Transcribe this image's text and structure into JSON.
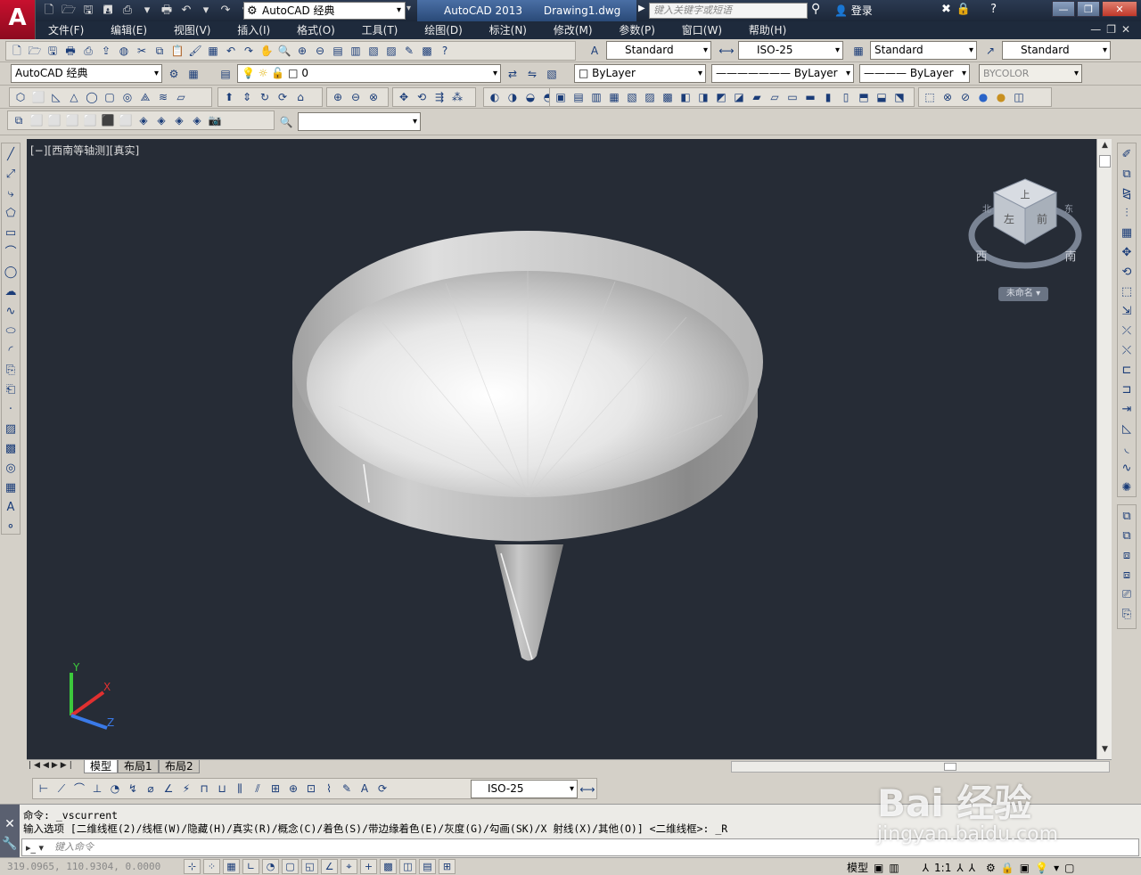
{
  "titlebar": {
    "app_logo": "A",
    "workspace": "AutoCAD 经典",
    "app_name": "AutoCAD 2013",
    "document": "Drawing1.dwg",
    "search_placeholder": "键入关键字或短语",
    "login": "登录",
    "window_buttons": [
      "—",
      "❐",
      "✕"
    ]
  },
  "menu": {
    "items": [
      "文件(F)",
      "编辑(E)",
      "视图(V)",
      "插入(I)",
      "格式(O)",
      "工具(T)",
      "绘图(D)",
      "标注(N)",
      "修改(M)",
      "参数(P)",
      "窗口(W)",
      "帮助(H)"
    ]
  },
  "styles_toolbar": {
    "text_style": "Standard",
    "dim_style": "ISO-25",
    "table_style": "Standard",
    "multileader_style": "Standard"
  },
  "layers_toolbar": {
    "workspace": "AutoCAD 经典",
    "current_layer": "0",
    "color": "ByLayer",
    "linetype": "ByLayer",
    "lineweight": "ByLayer",
    "plot_style": "BYCOLOR"
  },
  "viewport": {
    "label": "[−][西南等轴测][真实]",
    "viewcube_top": "上",
    "viewcube_front": "前",
    "viewcube_left": "左",
    "compass_west": "西",
    "compass_south": "南",
    "compass_north": "北",
    "compass_east": "东",
    "ucs_name": "未命名",
    "ucs_x": "X",
    "ucs_y": "Y",
    "ucs_z": "Z"
  },
  "layout_tabs": [
    "模型",
    "布局1",
    "布局2"
  ],
  "dim_toolbar": {
    "dim_style": "ISO-25"
  },
  "command": {
    "line1": "命令: _vscurrent",
    "line2": "输入选项 [二维线框(2)/线框(W)/隐藏(H)/真实(R)/概念(C)/着色(S)/带边缘着色(E)/灰度(G)/勾画(SK)/X 射线(X)/其他(O)] <二维线框>: _R",
    "input_placeholder": "键入命令"
  },
  "status": {
    "coordinates": "319.0965, 110.9304, 0.0000",
    "model_label": "模型",
    "scale": "1:1"
  },
  "watermark": {
    "main": "Bai  经验",
    "sub": "jingyan.baidu.com"
  },
  "colors": {
    "viewport_bg": "#262c36",
    "titlebar_bg": "#1c2738",
    "logo_red": "#c8102e"
  }
}
